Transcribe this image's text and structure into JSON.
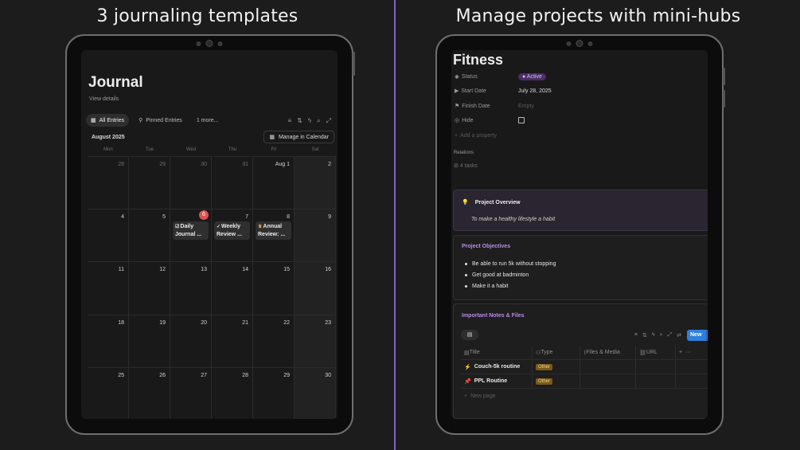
{
  "left": {
    "heading": "3 journaling templates",
    "page_title": "Journal",
    "view_details": "View details",
    "tabs": [
      {
        "label": "All Entries",
        "icon": "calendar-icon"
      },
      {
        "label": "Pinned Entries",
        "icon": "pin-icon"
      },
      {
        "label": "1 more..."
      }
    ],
    "month": "August 2025",
    "manage_label": "Manage in Calendar",
    "weekdays": [
      "Mon",
      "Tue",
      "Wed",
      "Thu",
      "Fri",
      "Sat"
    ],
    "weeks": [
      [
        "28",
        "29",
        "30",
        "31",
        "Aug 1",
        "2"
      ],
      [
        "4",
        "5",
        "6",
        "7",
        "8",
        "9"
      ],
      [
        "11",
        "12",
        "13",
        "14",
        "15",
        "16"
      ],
      [
        "18",
        "19",
        "20",
        "21",
        "22",
        "23"
      ],
      [
        "25",
        "26",
        "27",
        "28",
        "29",
        "30"
      ]
    ],
    "events": {
      "daily": "Daily Journal ...",
      "weekly": "Weekly Review ...",
      "annual": "Annual Review: ..."
    }
  },
  "right": {
    "heading": "Manage projects with mini-hubs",
    "page_title": "Fitness",
    "properties": {
      "status_label": "Status",
      "status_value": "Active",
      "start_label": "Start Date",
      "start_value": "July 28, 2025",
      "finish_label": "Finish Date",
      "finish_value": "Empty",
      "hide_label": "Hide",
      "add_label": "Add a property"
    },
    "relations_label": "Relations",
    "tasks_label": "4 tasks",
    "overview_title": "Project Overview",
    "overview_text": "To make a healthy lifestyle a habit",
    "objectives_title": "Project Objectives",
    "objectives": [
      "Be able to run 5k without stopping",
      "Get good at badminton",
      "Make it a habit"
    ],
    "notes_title": "Important Notes & Files",
    "new_label": "New",
    "columns": [
      "Title",
      "Type",
      "Files & Media",
      "URL"
    ],
    "rows": [
      {
        "title": "Couch-5k routine",
        "type": "Other"
      },
      {
        "title": "PPL Routine",
        "type": "Other"
      }
    ],
    "new_page": "New page"
  },
  "colors": {
    "accent_divider": "#7b61c8",
    "today": "#d9534f",
    "new_button": "#2f7fe0",
    "status_pill": "#4a2f62"
  }
}
